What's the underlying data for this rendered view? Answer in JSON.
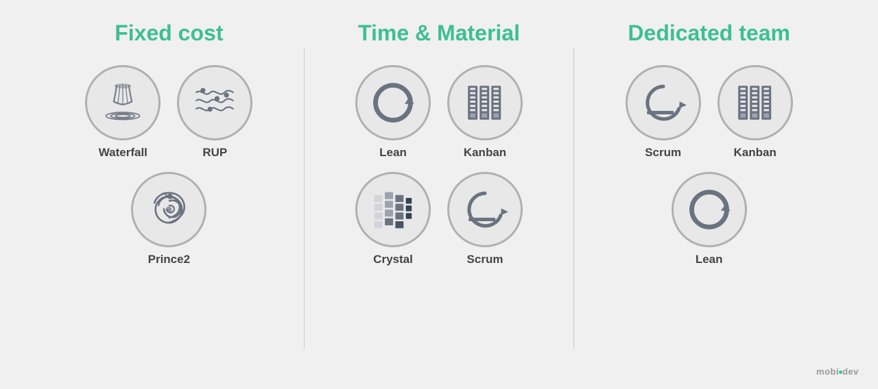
{
  "sections": [
    {
      "id": "fixed-cost",
      "title": "Fixed cost",
      "rows": [
        [
          {
            "id": "waterfall",
            "label": "Waterfall",
            "icon": "waterfall"
          },
          {
            "id": "rup",
            "label": "RUP",
            "icon": "rup"
          }
        ],
        [
          {
            "id": "prince2",
            "label": "Prince2",
            "icon": "prince2"
          }
        ]
      ]
    },
    {
      "id": "time-material",
      "title": "Time & Material",
      "rows": [
        [
          {
            "id": "lean1",
            "label": "Lean",
            "icon": "lean"
          },
          {
            "id": "kanban1",
            "label": "Kanban",
            "icon": "kanban"
          }
        ],
        [
          {
            "id": "crystal",
            "label": "Crystal",
            "icon": "crystal"
          },
          {
            "id": "scrum1",
            "label": "Scrum",
            "icon": "scrum"
          }
        ]
      ]
    },
    {
      "id": "dedicated-team",
      "title": "Dedicated team",
      "rows": [
        [
          {
            "id": "scrum2",
            "label": "Scrum",
            "icon": "scrum"
          },
          {
            "id": "kanban2",
            "label": "Kanban",
            "icon": "kanban"
          }
        ],
        [
          {
            "id": "lean2",
            "label": "Lean",
            "icon": "lean"
          }
        ]
      ]
    }
  ],
  "brand": {
    "name": "mobidev"
  },
  "colors": {
    "accent": "#3dbf94",
    "text": "#444444",
    "border": "#b0b0b0",
    "background": "#f0f0f0",
    "icon_fill": "#6b7280"
  }
}
